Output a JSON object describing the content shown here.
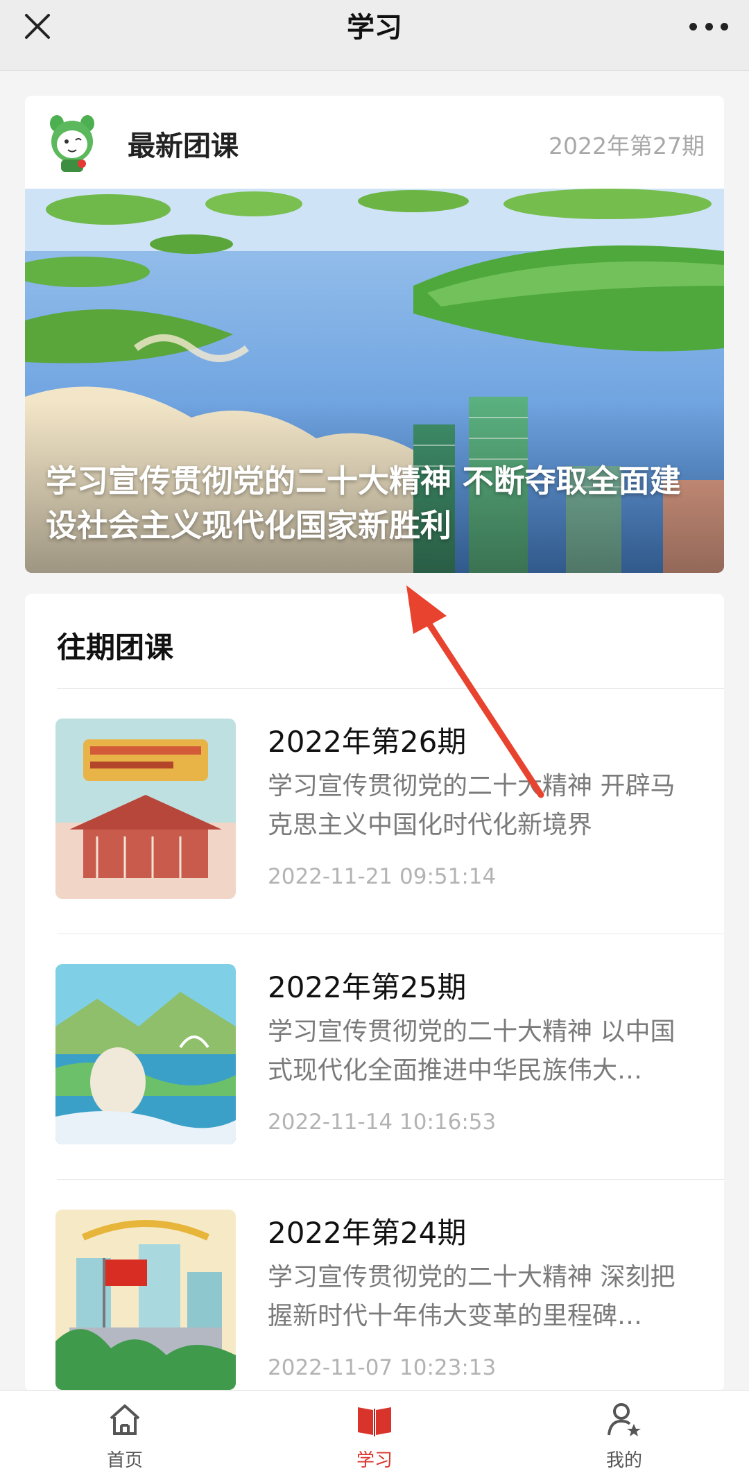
{
  "header": {
    "title": "学习"
  },
  "latest": {
    "label": "最新团课",
    "issue": "2022年第27期",
    "caption": "学习宣传贯彻党的二十大精神 不断夺取全面建设社会主义现代化国家新胜利"
  },
  "past": {
    "section_title": "往期团课",
    "items": [
      {
        "title": "2022年第26期",
        "desc": "学习宣传贯彻党的二十大精神 开辟马克思主义中国化时代化新境界",
        "date": "2022-11-21 09:51:14"
      },
      {
        "title": "2022年第25期",
        "desc": "学习宣传贯彻党的二十大精神 以中国式现代化全面推进中华民族伟大…",
        "date": "2022-11-14 10:16:53"
      },
      {
        "title": "2022年第24期",
        "desc": "学习宣传贯彻党的二十大精神 深刻把握新时代十年伟大变革的里程碑…",
        "date": "2022-11-07 10:23:13"
      }
    ]
  },
  "tabs": [
    {
      "label": "首页",
      "icon": "home-icon"
    },
    {
      "label": "学习",
      "icon": "book-icon"
    },
    {
      "label": "我的",
      "icon": "profile-icon"
    }
  ],
  "colors": {
    "accent": "#d9342b",
    "background": "#f4f4f4",
    "annotation_arrow": "#e8432e"
  }
}
